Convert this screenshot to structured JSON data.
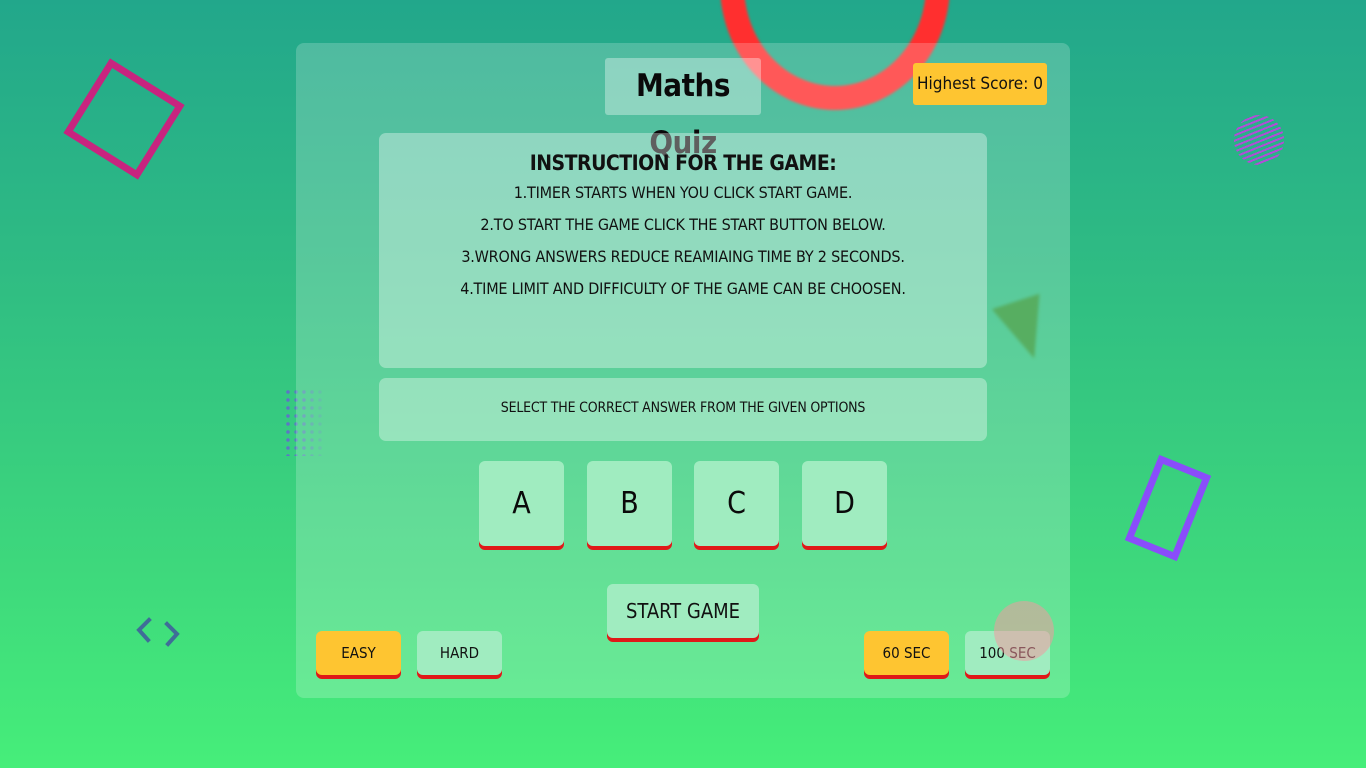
{
  "header": {
    "title": "Maths Quiz",
    "highest_score": "Highest Score: 0"
  },
  "instructions": {
    "heading": "INSTRUCTION FOR THE GAME:",
    "lines": [
      "1.TIMER STARTS WHEN YOU CLICK START GAME.",
      "2.TO START THE GAME CLICK THE START BUTTON BELOW.",
      "3.WRONG ANSWERS REDUCE REAMIAING TIME BY 2 SECONDS.",
      "4.TIME LIMIT AND DIFFICULTY OF THE GAME CAN BE CHOOSEN."
    ]
  },
  "question": {
    "text": "SELECT THE CORRECT ANSWER FROM THE GIVEN OPTIONS"
  },
  "options": [
    "A",
    "B",
    "C",
    "D"
  ],
  "controls": {
    "start_label": "START GAME",
    "difficulty": [
      "EASY",
      "HARD"
    ],
    "time_limits": [
      "60 SEC",
      "100 SEC"
    ]
  },
  "colors": {
    "accent_yellow": "#fec531",
    "button_mint": "#a0ecc0",
    "button_underline_red": "#e01818",
    "background_top": "#22a78b",
    "background_bottom": "#46ee7a"
  },
  "icons": [
    "code-brackets-icon"
  ]
}
